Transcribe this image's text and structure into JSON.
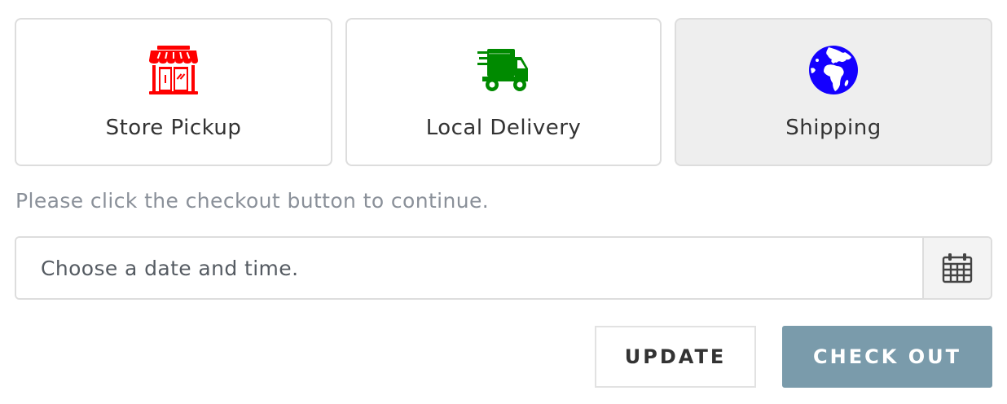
{
  "delivery_options": [
    {
      "label": "Store Pickup",
      "icon": "store-icon",
      "color": "#ff0000",
      "selected": false
    },
    {
      "label": "Local Delivery",
      "icon": "delivery-truck-icon",
      "color": "#008a00",
      "selected": false
    },
    {
      "label": "Shipping",
      "icon": "globe-icon",
      "color": "#1400ff",
      "selected": true
    }
  ],
  "hint_text": "Please click the checkout button to continue.",
  "date_picker": {
    "placeholder": "Choose a date and time.",
    "value": "",
    "icon": "calendar-icon"
  },
  "actions": {
    "update_label": "UPDATE",
    "checkout_label": "CHECK OUT"
  },
  "colors": {
    "checkout_bg": "#7a9bab",
    "selected_option_bg": "#eeeeee",
    "border": "#dddddd"
  }
}
